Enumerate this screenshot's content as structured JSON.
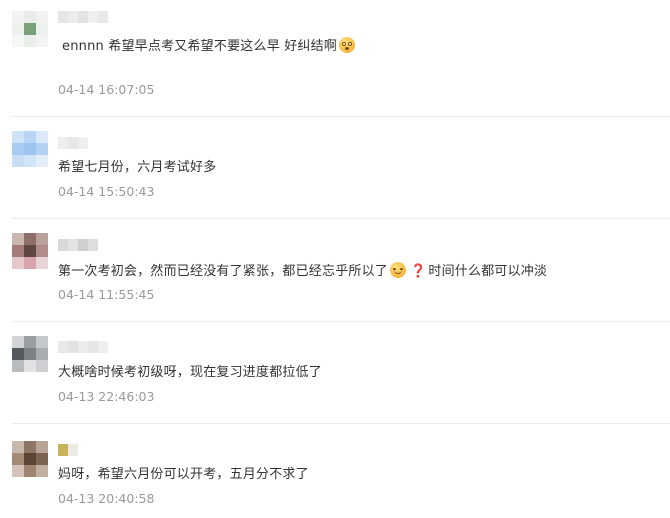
{
  "comments": [
    {
      "text_before": "ennnn  希望早点考又希望不要这么早  好纠结啊",
      "emoji": "flushed-face-emoji",
      "time": "04-14 16:07:05",
      "avatar_colors": [
        "#f3f3f3",
        "#e9ece9",
        "#f1f2f1",
        "#eef0ee",
        "#7aa17c",
        "#eef0ee",
        "#f6f6f6",
        "#eceeec",
        "#f4f4f4"
      ],
      "name_colors": [
        "#e6e6e6",
        "#ededed",
        "#e3e3e3",
        "#efefef",
        "#e8e8e8"
      ]
    },
    {
      "text_before": "希望七月份，六月考试好多",
      "time": "04-14 15:50:43",
      "avatar_colors": [
        "#cfe3f7",
        "#b7d5f4",
        "#d9e9f8",
        "#a8cbf0",
        "#9dc4ef",
        "#b3d2f3",
        "#c7def6",
        "#d2e5f7",
        "#e2eef9"
      ],
      "name_colors": [
        "#eeeeee",
        "#e7e7e7",
        "#efefef"
      ]
    },
    {
      "text_before": "第一次考初会，然而已经没有了紧张，都已经忘乎所以了",
      "emoji": "smiling-face-emoji",
      "text_after": "时间什么都可以冲淡",
      "time": "04-14 11:55:45",
      "avatar_colors": [
        "#c9b7b0",
        "#8c6f66",
        "#b9a29b",
        "#a47b76",
        "#5e4642",
        "#b08d88",
        "#e4c8cc",
        "#d7a4ad",
        "#e8d3d6"
      ],
      "name_colors": [
        "#d9d9d9",
        "#e4e4e4",
        "#cfcfcf",
        "#dedede"
      ]
    },
    {
      "text_before": "大概啥时候考初级呀，现在复习进度都拉低了",
      "time": "04-13 22:46:03",
      "avatar_colors": [
        "#d2d4d6",
        "#9a9ea2",
        "#c5c8cb",
        "#55595e",
        "#7c8186",
        "#a8acb0",
        "#b9bcbf",
        "#e0e2e4",
        "#cdd0d2"
      ],
      "name_colors": [
        "#e8e8e8",
        "#e2e2e2",
        "#ececec",
        "#e6e6e6",
        "#efefef"
      ]
    },
    {
      "text_before": "妈呀，希望六月份可以开考，五月分不求了",
      "time": "04-13 20:40:58",
      "avatar_colors": [
        "#c8b9ae",
        "#8f7565",
        "#b7a496",
        "#a58a78",
        "#5a4537",
        "#7d6352",
        "#d2c4ba",
        "#a08472",
        "#c1afa2"
      ],
      "name_colors": [
        "#c8b45a",
        "#ecebe4"
      ]
    }
  ]
}
